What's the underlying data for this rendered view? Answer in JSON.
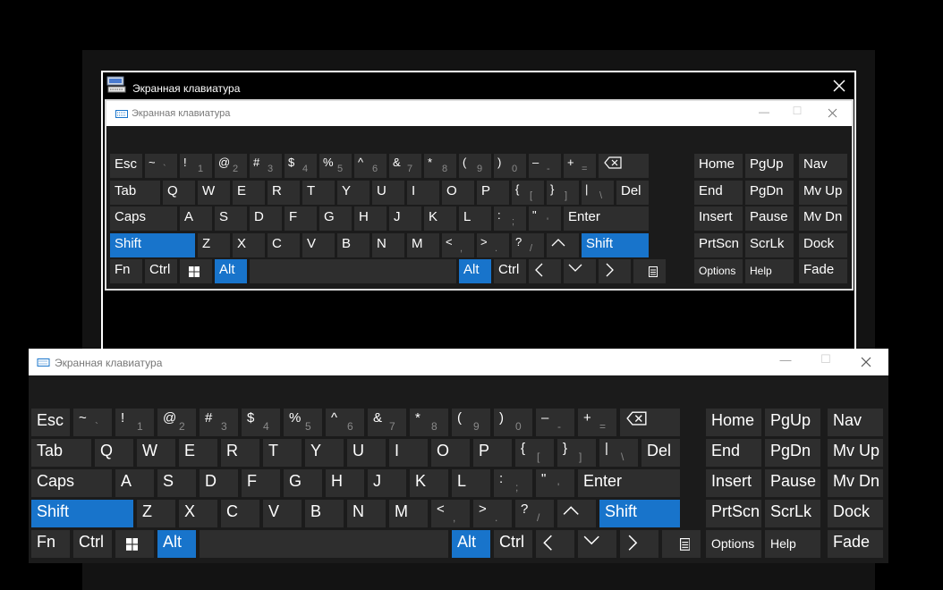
{
  "outer_window": {
    "title": "Экранная клавиатура"
  },
  "osk_title": "Экранная клавиатура",
  "rows": [
    [
      {
        "id": "esc",
        "label": "Esc",
        "w": 1
      },
      {
        "id": "tilde",
        "label": "~",
        "sub": "`",
        "w": 1
      },
      {
        "id": "1",
        "label": "!",
        "sub": "1",
        "w": 1
      },
      {
        "id": "2",
        "label": "@",
        "sub": "2",
        "w": 1
      },
      {
        "id": "3",
        "label": "#",
        "sub": "3",
        "w": 1
      },
      {
        "id": "4",
        "label": "$",
        "sub": "4",
        "w": 1
      },
      {
        "id": "5",
        "label": "%",
        "sub": "5",
        "w": 1
      },
      {
        "id": "6",
        "label": "^",
        "sub": "6",
        "w": 1
      },
      {
        "id": "7",
        "label": "&",
        "sub": "7",
        "w": 1
      },
      {
        "id": "8",
        "label": "*",
        "sub": "8",
        "w": 1
      },
      {
        "id": "9",
        "label": "(",
        "sub": "9",
        "w": 1
      },
      {
        "id": "0",
        "label": ")",
        "sub": "0",
        "w": 1
      },
      {
        "id": "minus",
        "label": "–",
        "sub": "-",
        "w": 1
      },
      {
        "id": "plus",
        "label": "+",
        "sub": "=",
        "w": 1
      },
      {
        "id": "backspace",
        "icon": "backspace-icon",
        "w": 1.5
      }
    ],
    [
      {
        "id": "tab",
        "label": "Tab",
        "w": 1.5
      },
      {
        "id": "q",
        "label": "Q",
        "w": 1
      },
      {
        "id": "w",
        "label": "W",
        "w": 1
      },
      {
        "id": "e",
        "label": "E",
        "w": 1
      },
      {
        "id": "r",
        "label": "R",
        "w": 1
      },
      {
        "id": "t",
        "label": "T",
        "w": 1
      },
      {
        "id": "y",
        "label": "Y",
        "w": 1
      },
      {
        "id": "u",
        "label": "U",
        "w": 1
      },
      {
        "id": "i",
        "label": "I",
        "w": 1
      },
      {
        "id": "o",
        "label": "O",
        "w": 1
      },
      {
        "id": "p",
        "label": "P",
        "w": 1
      },
      {
        "id": "lbrace",
        "label": "{",
        "sub": "[",
        "w": 1
      },
      {
        "id": "rbrace",
        "label": "}",
        "sub": "]",
        "w": 1
      },
      {
        "id": "pipe",
        "label": "|",
        "sub": "\\",
        "w": 1
      },
      {
        "id": "del",
        "label": "Del",
        "w": 1
      }
    ],
    [
      {
        "id": "caps",
        "label": "Caps",
        "w": 2
      },
      {
        "id": "a",
        "label": "A",
        "w": 1
      },
      {
        "id": "s",
        "label": "S",
        "w": 1
      },
      {
        "id": "d",
        "label": "D",
        "w": 1
      },
      {
        "id": "f",
        "label": "F",
        "w": 1
      },
      {
        "id": "g",
        "label": "G",
        "w": 1
      },
      {
        "id": "h",
        "label": "H",
        "w": 1
      },
      {
        "id": "j",
        "label": "J",
        "w": 1
      },
      {
        "id": "k",
        "label": "K",
        "w": 1
      },
      {
        "id": "l",
        "label": "L",
        "w": 1
      },
      {
        "id": "colon",
        "label": ":",
        "sub": ";",
        "w": 1
      },
      {
        "id": "quote",
        "label": "\"",
        "sub": "'",
        "w": 1
      },
      {
        "id": "enter",
        "label": "Enter",
        "w": 2.5
      }
    ],
    [
      {
        "id": "lshift",
        "label": "Shift",
        "w": 2.5,
        "active": true
      },
      {
        "id": "z",
        "label": "Z",
        "w": 1
      },
      {
        "id": "x",
        "label": "X",
        "w": 1
      },
      {
        "id": "c",
        "label": "C",
        "w": 1
      },
      {
        "id": "v",
        "label": "V",
        "w": 1
      },
      {
        "id": "b",
        "label": "B",
        "w": 1
      },
      {
        "id": "n",
        "label": "N",
        "w": 1
      },
      {
        "id": "m",
        "label": "M",
        "w": 1
      },
      {
        "id": "lt",
        "label": "<",
        "sub": ",",
        "w": 1
      },
      {
        "id": "gt",
        "label": ">",
        "sub": ".",
        "w": 1
      },
      {
        "id": "question",
        "label": "?",
        "sub": "/",
        "w": 1
      },
      {
        "id": "up",
        "icon": "chevron-up-icon",
        "w": 1
      },
      {
        "id": "rshift",
        "label": "Shift",
        "w": 2,
        "active": true
      }
    ],
    [
      {
        "id": "fn",
        "label": "Fn",
        "w": 1
      },
      {
        "id": "lctrl",
        "label": "Ctrl",
        "w": 1
      },
      {
        "id": "win",
        "icon": "windows-icon",
        "w": 1
      },
      {
        "id": "lalt",
        "label": "Alt",
        "w": 1,
        "active": true
      },
      {
        "id": "space",
        "label": "",
        "w": 6
      },
      {
        "id": "ralt",
        "label": "Alt",
        "w": 1,
        "active": true
      },
      {
        "id": "rctrl",
        "label": "Ctrl",
        "w": 1
      },
      {
        "id": "left",
        "icon": "chevron-left-icon",
        "w": 1
      },
      {
        "id": "down",
        "icon": "chevron-down-icon",
        "w": 1
      },
      {
        "id": "right",
        "icon": "chevron-right-icon",
        "w": 1
      },
      {
        "id": "menu",
        "icon": "menu-icon",
        "w": 1
      }
    ]
  ],
  "nav": [
    [
      {
        "id": "home",
        "label": "Home"
      },
      {
        "id": "pgup",
        "label": "PgUp"
      },
      {
        "id": "nav",
        "label": "Nav",
        "gap": true
      }
    ],
    [
      {
        "id": "end",
        "label": "End"
      },
      {
        "id": "pgdn",
        "label": "PgDn"
      },
      {
        "id": "mvup",
        "label": "Mv Up",
        "gap": true
      }
    ],
    [
      {
        "id": "insert",
        "label": "Insert"
      },
      {
        "id": "pause",
        "label": "Pause"
      },
      {
        "id": "mvdn",
        "label": "Mv Dn",
        "gap": true
      }
    ],
    [
      {
        "id": "prtscn",
        "label": "PrtScn"
      },
      {
        "id": "scrlk",
        "label": "ScrLk"
      },
      {
        "id": "dock",
        "label": "Dock",
        "gap": true
      }
    ],
    [
      {
        "id": "options",
        "label": "Options",
        "small": true
      },
      {
        "id": "help",
        "label": "Help",
        "small": true
      },
      {
        "id": "fade",
        "label": "Fade",
        "gap": true
      }
    ]
  ],
  "colors": {
    "active": "#1874cb",
    "key": "#2e2e2e",
    "window_bg": "#1b1b1b"
  }
}
